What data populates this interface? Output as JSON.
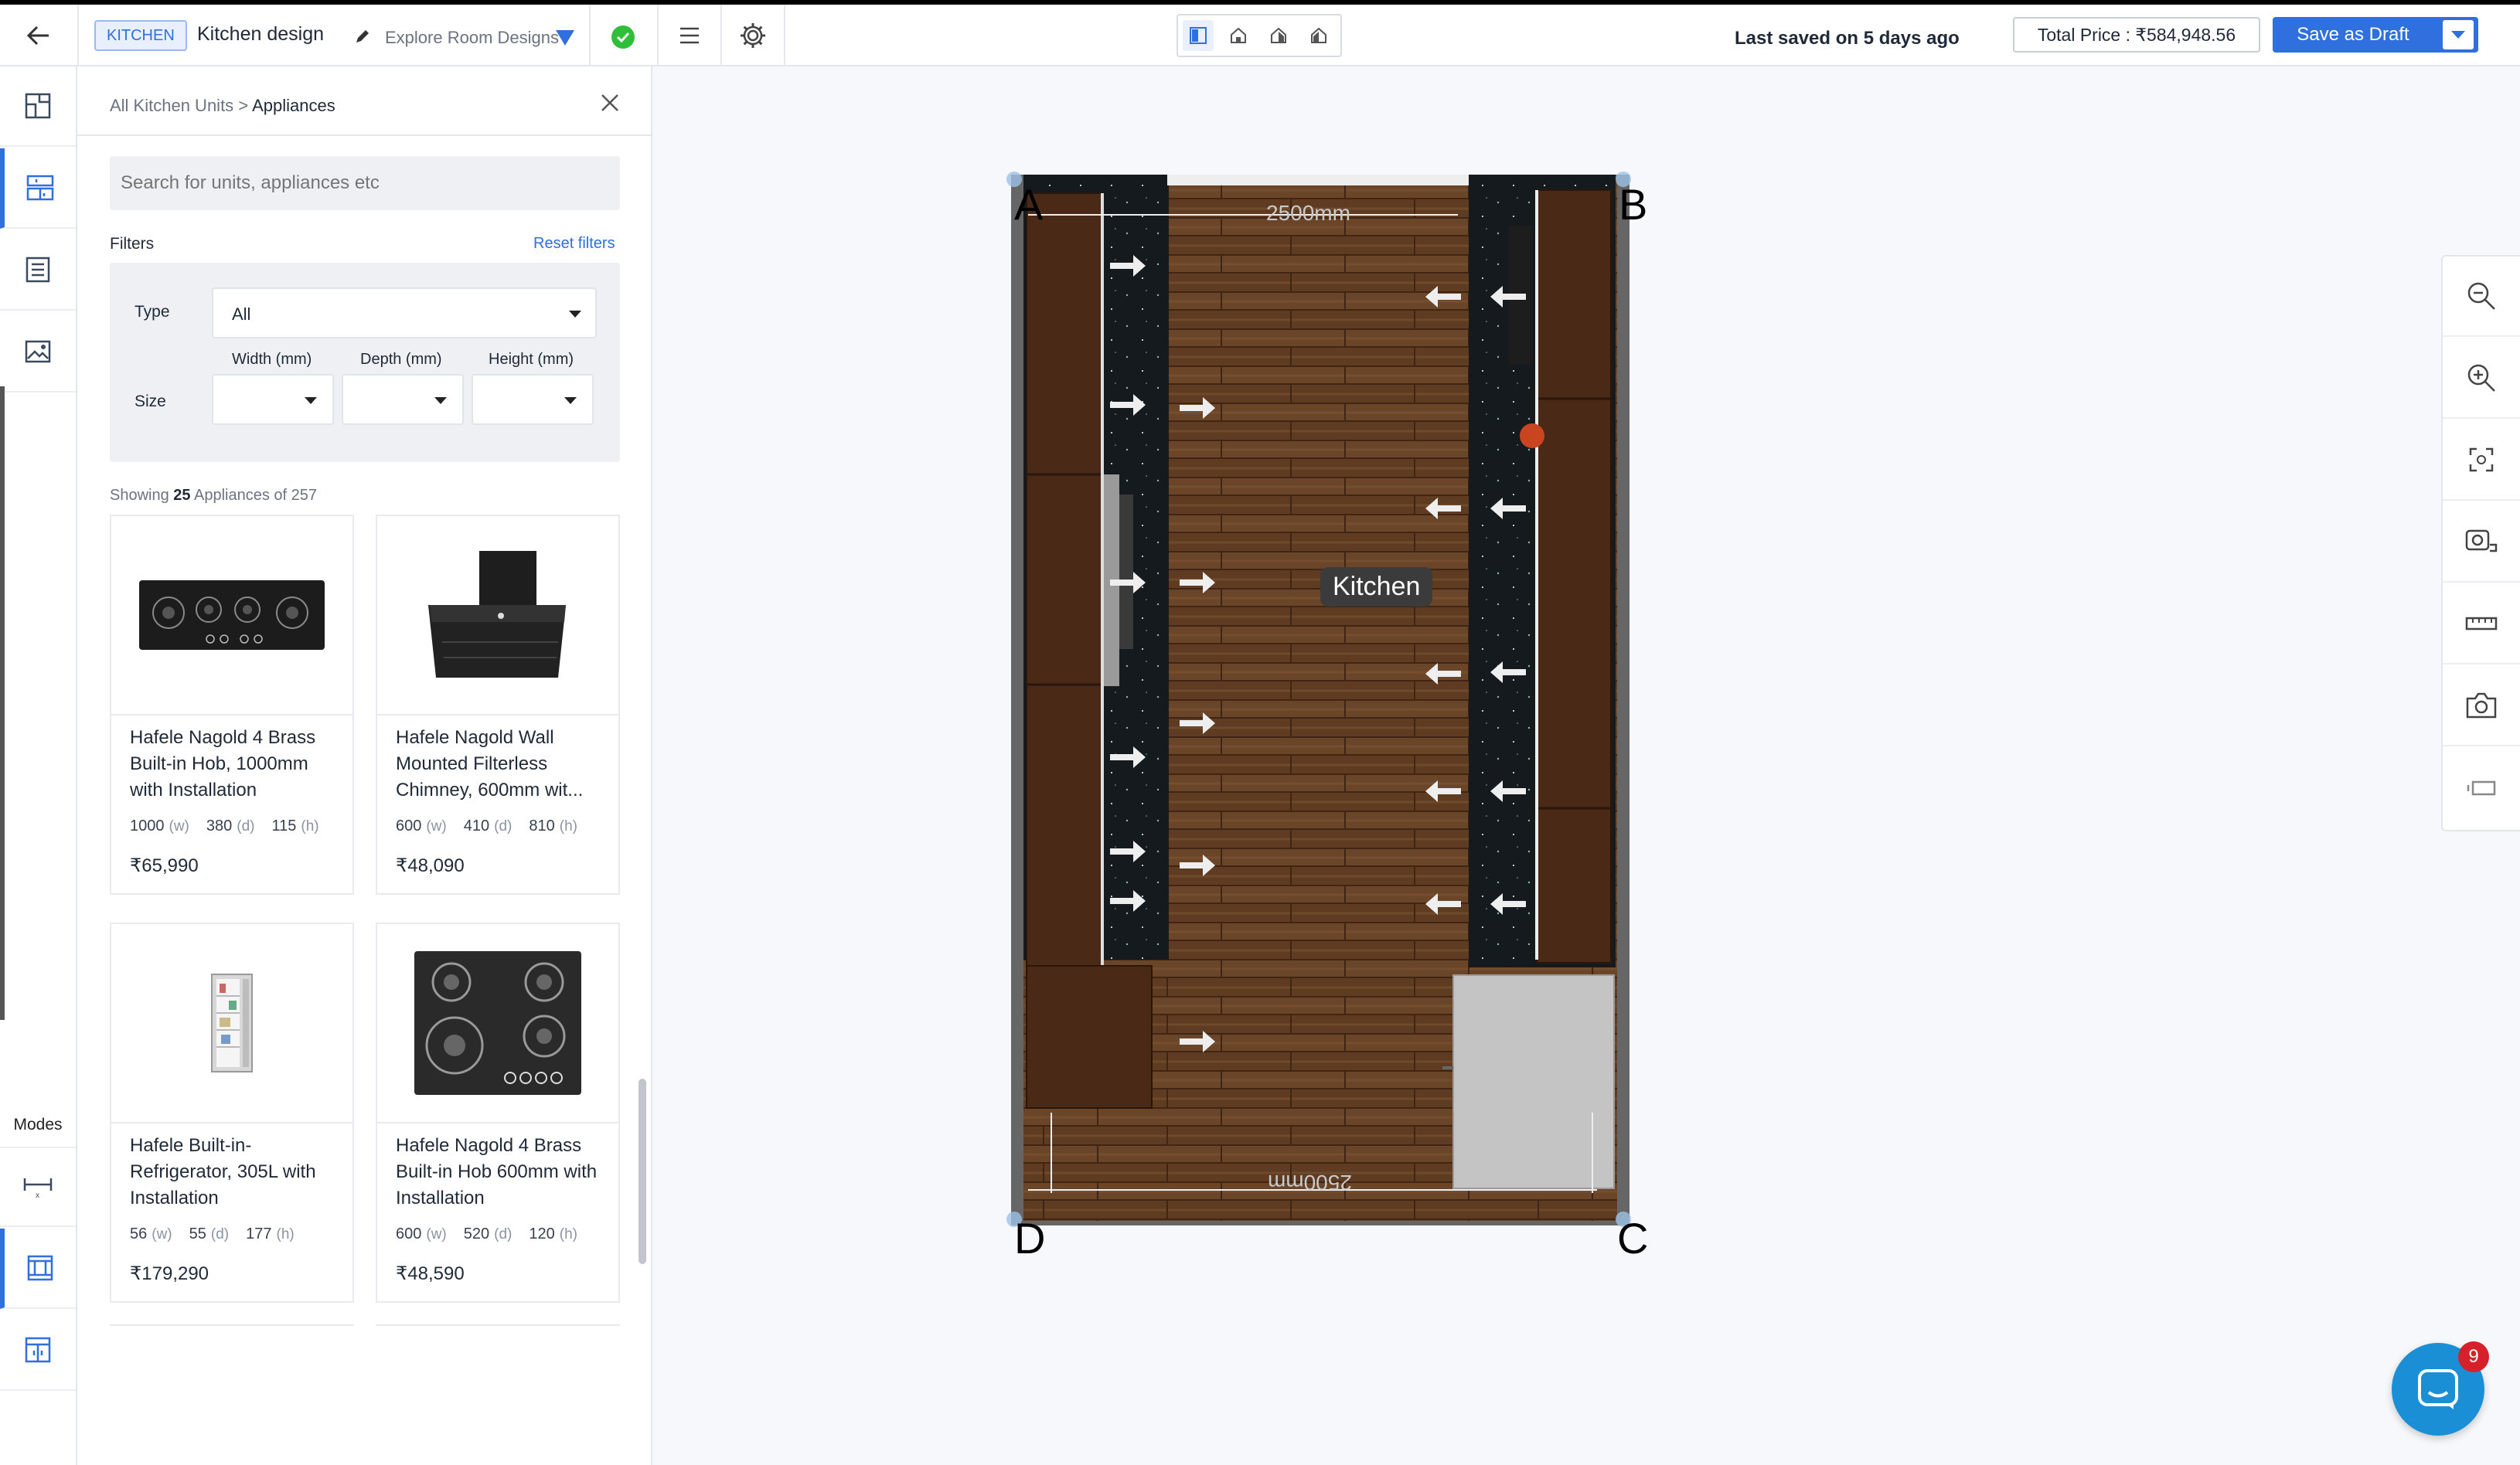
{
  "topbar": {
    "room_badge": "KITCHEN",
    "project_name": "Kitchen design",
    "explore_label": "Explore Room Designs",
    "last_saved": "Last saved on 5 days ago",
    "total_price": "Total Price : ₹584,948.56",
    "save_label": "Save as Draft",
    "accent": "#2f6fde"
  },
  "rail": {
    "modes_label": "Modes",
    "items": [
      "floorplan-icon",
      "units-icon",
      "list-icon",
      "image-icon",
      "dimension-icon",
      "elevation-icon",
      "cabinet-icon"
    ]
  },
  "panel": {
    "breadcrumb_root": "All Kitchen Units",
    "breadcrumb_sep": ">",
    "breadcrumb_current": "Appliances",
    "search_placeholder": "Search for units, appliances etc",
    "filters_title": "Filters",
    "reset_filters": "Reset filters",
    "type_label": "Type",
    "type_value": "All",
    "size_label": "Size",
    "width_label": "Width (mm)",
    "depth_label": "Depth (mm)",
    "height_label": "Height (mm)",
    "showing_prefix": "Showing",
    "showing_count": "25",
    "showing_suffix": "Appliances of 257",
    "products": [
      {
        "name": "Hafele Nagold 4 Brass Built-in Hob, 1000mm with Installation",
        "w": "1000",
        "d": "380",
        "h": "115",
        "price": "₹65,990"
      },
      {
        "name": "Hafele Nagold Wall Mounted Filterless Chimney, 600mm wit...",
        "w": "600",
        "d": "410",
        "h": "810",
        "price": "₹48,090"
      },
      {
        "name": "Hafele Built-in-Refrigerator, 305L with Installation",
        "w": "56",
        "d": "55",
        "h": "177",
        "price": "₹179,290"
      },
      {
        "name": "Hafele Nagold 4 Brass Built-in Hob 600mm with Installation",
        "w": "600",
        "d": "520",
        "h": "120",
        "price": "₹48,590"
      }
    ],
    "unit_w": "(w)",
    "unit_d": "(d)",
    "unit_h": "(h)"
  },
  "canvas": {
    "room_label": "Kitchen",
    "dim_top": "2500mm",
    "dim_bottom": "2500mm",
    "corner_a": "A",
    "corner_b": "B",
    "corner_c": "C",
    "corner_d": "D"
  },
  "chat": {
    "badge_count": "9"
  }
}
